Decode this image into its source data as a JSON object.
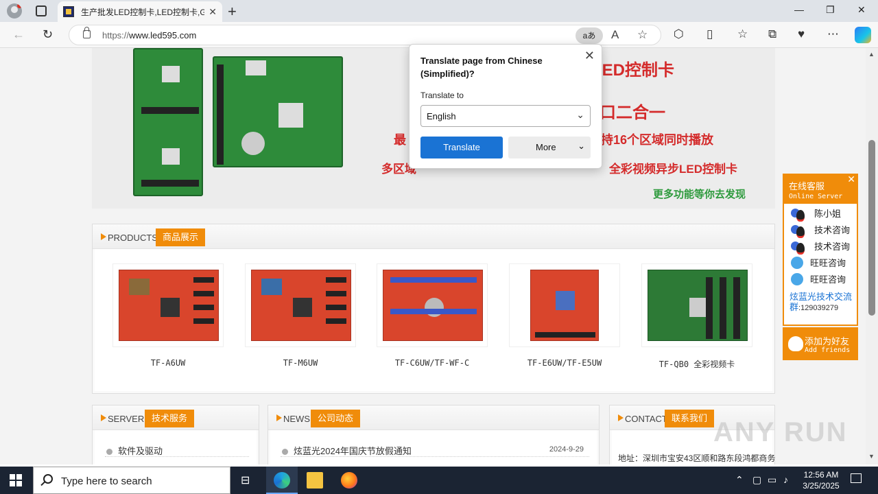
{
  "browser": {
    "tab_title": "生产批发LED控制卡,LED控制卡,G",
    "tab_close": "✕",
    "new_tab": "+",
    "url_scheme": "https://",
    "url_host": "www.led595.com",
    "read_aloud_label": "aあ",
    "win_min": "—",
    "win_max": "❐",
    "win_close": "✕"
  },
  "banner": {
    "line1": "彩LED控制卡",
    "line2": "口二合一",
    "line3_a": "最",
    "line3_b": "持16个区域同时播放",
    "line4_a": "多区域",
    "line4_b": "全彩视频异步LED控制卡",
    "more": "更多功能等你去发现"
  },
  "translate_popup": {
    "title": "Translate page from Chinese (Simplified)?",
    "label": "Translate to",
    "selected_language": "English",
    "translate_button": "Translate",
    "more_button": "More",
    "close": "✕"
  },
  "products": {
    "en": "PRODUCTS",
    "cn": "商品展示",
    "items": [
      {
        "label": "TF-A6UW"
      },
      {
        "label": "TF-M6UW"
      },
      {
        "label": "TF-C6UW/TF-WF-C"
      },
      {
        "label": "TF-E6UW/TF-E5UW"
      },
      {
        "label": "TF-QB0 全彩视频卡"
      }
    ]
  },
  "server": {
    "en": "SERVER",
    "cn": "技术服务",
    "items": [
      "软件及驱动"
    ]
  },
  "news": {
    "en": "NEWS",
    "cn": "公司动态",
    "items": [
      {
        "title": "炫蓝光2024年国庆节放假通知",
        "date": "2024-9-29"
      }
    ]
  },
  "contact": {
    "en": "CONTACT",
    "cn": "联系我们",
    "address": "地址：深圳市宝安43区顺和路东段鸿都商务"
  },
  "service_widget": {
    "title": "在线客服",
    "subtitle": "Online Server",
    "close": "✕",
    "items": [
      "陈小姐",
      "技术咨询",
      "技术咨询",
      "旺旺咨询",
      "旺旺咨询"
    ],
    "tech_group": "炫蓝光技术交流群",
    "tech_number": ":129039279",
    "add_title": "添加为好友",
    "add_sub": "Add friends"
  },
  "watermark": "ANY RUN",
  "taskbar": {
    "search_placeholder": "Type here to search",
    "time": "12:56 AM",
    "date": "3/25/2025"
  }
}
